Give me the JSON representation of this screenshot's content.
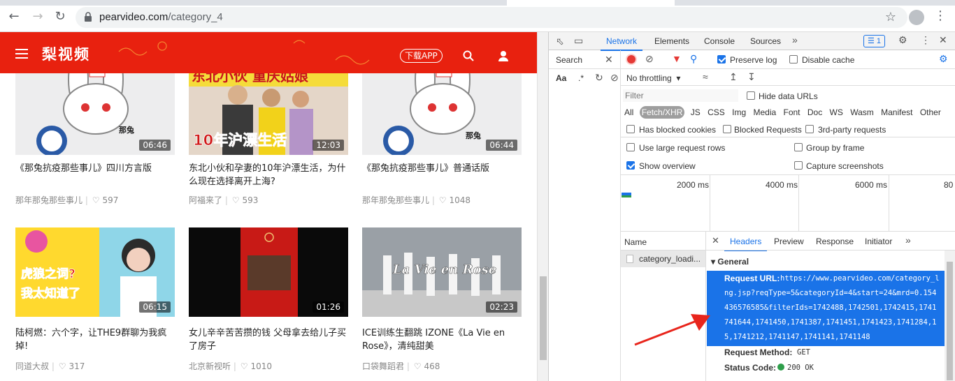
{
  "browser": {
    "url_host": "pearvideo.com",
    "url_path": "/category_4",
    "back_icon": "arrow-left",
    "forward_icon": "arrow-right",
    "reload_icon": "reload"
  },
  "site": {
    "logo": "梨视频",
    "download_app": "下载APP",
    "brand_color": "#e8210f",
    "cards": [
      {
        "title": "《那兔抗疫那些事儿》四川方言版",
        "author": "那年那兔那些事儿",
        "likes": "597",
        "duration": "06:46"
      },
      {
        "title": "东北小伙和孕妻的10年沪漂生活，为什么现在选择离开上海?",
        "author": "阿福来了",
        "likes": "593",
        "duration": "12:03"
      },
      {
        "title": "《那兔抗疫那些事儿》普通话版",
        "author": "那年那兔那些事儿",
        "likes": "1048",
        "duration": "06:44"
      },
      {
        "title": "陆柯燃：六个字，让THE9群聊为我疯掉!",
        "author": "同道大叔",
        "likes": "317",
        "duration": "06:15"
      },
      {
        "title": "女儿辛辛苦苦攒的钱 父母拿去给儿子买了房子",
        "author": "北京新视听",
        "likes": "1010",
        "duration": "01:26"
      },
      {
        "title": "ICE训练生翻跳 IZONE《La Vie en Rose》，清纯甜美",
        "author": "口袋舞蹈君",
        "likes": "468",
        "duration": "02:23"
      }
    ],
    "thumb_texts": {
      "t2_top": "东北小伙  重庆姑娘",
      "t2_bottom": "10年沪漂生活",
      "t4_line1": "虎狼之词?",
      "t4_line2": "我太知道了",
      "t6_text": "La Vie en Rose",
      "t1_tag": "那兔",
      "t3_tag": "那兔"
    }
  },
  "devtools": {
    "tabs": [
      "Network",
      "Elements",
      "Console",
      "Sources"
    ],
    "active_tab": "Network",
    "issues_count": "1",
    "search_label": "Search",
    "preserve_log": "Preserve log",
    "disable_cache": "Disable cache",
    "throttling": "No throttling",
    "filter_placeholder": "Filter",
    "hide_data_urls": "Hide data URLs",
    "type_filters": [
      "All",
      "Fetch/XHR",
      "JS",
      "CSS",
      "Img",
      "Media",
      "Font",
      "Doc",
      "WS",
      "Wasm",
      "Manifest",
      "Other"
    ],
    "active_type": "Fetch/XHR",
    "has_blocked_cookies": "Has blocked cookies",
    "blocked_requests": "Blocked Requests",
    "third_party": "3rd-party requests",
    "use_large_rows": "Use large request rows",
    "group_by_frame": "Group by frame",
    "show_overview": "Show overview",
    "capture_screenshots": "Capture screenshots",
    "timeline_labels": [
      "2000 ms",
      "4000 ms",
      "6000 ms",
      "80"
    ],
    "name_header": "Name",
    "request_name": "category_loadi...",
    "detail_tabs": [
      "Headers",
      "Preview",
      "Response",
      "Initiator"
    ],
    "active_detail_tab": "Headers",
    "section_general": "General",
    "request_url_label": "Request URL:",
    "request_url_lines": [
      "https://www.pearvideo.com/category_l",
      "ng.jsp?reqType=5&categoryId=4&start=24&mrd=0.154",
      "436576585&filterIds=1742488,1742501,1742415,1741",
      "741644,1741450,1741387,1741451,1741423,1741284,1",
      "5,1741212,1741147,1741141,1741148"
    ],
    "request_method_label": "Request Method:",
    "request_method": "GET",
    "status_code_label": "Status Code:",
    "status_code": "200 OK",
    "highlight_color": "#1a73e8"
  }
}
